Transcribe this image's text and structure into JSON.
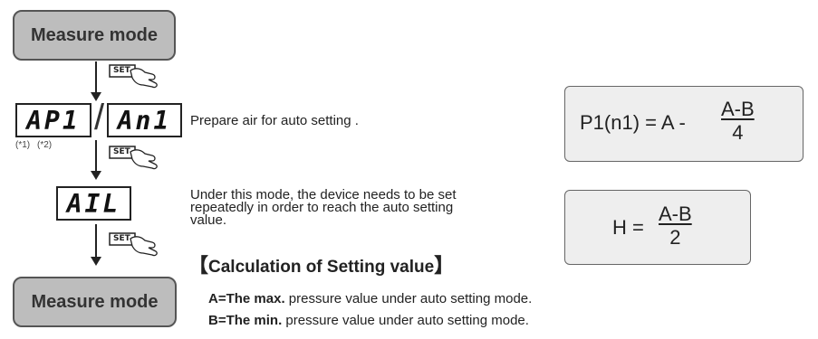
{
  "flow": {
    "mode_label_top": "Measure mode",
    "mode_label_bottom": "Measure mode",
    "set_label": "SET",
    "display_ap1": "AP1",
    "display_an1": "An1",
    "display_ail": "AIL",
    "note1": "(*1)",
    "note2": "(*2)"
  },
  "steps": {
    "prepare": "Prepare air for auto setting .",
    "repeat_line1": "Under this mode, the  device needs to be set",
    "repeat_line2": "repeatedly in order to reach the auto setting",
    "repeat_line3": "value."
  },
  "calc": {
    "open_bracket": "【",
    "title": "Calculation of  Setting value",
    "close_bracket": "】",
    "a_key": "A=The max.",
    "a_rest": " pressure value under auto setting mode.",
    "b_key": "B=The min.",
    "b_rest": " pressure value under auto setting mode."
  },
  "formulas": {
    "p1_lhs": "P1(n1) = A -",
    "p1_num": "A-B",
    "p1_den": "4",
    "h_lhs": "H =",
    "h_num": "A-B",
    "h_den": "2"
  }
}
